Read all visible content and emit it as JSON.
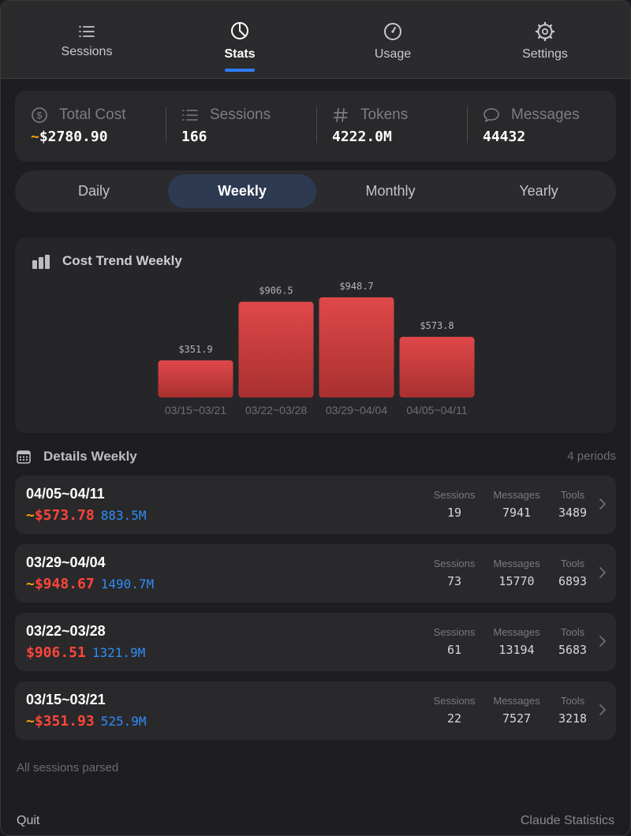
{
  "nav": {
    "tabs": [
      {
        "label": "Sessions",
        "icon": "list-icon"
      },
      {
        "label": "Stats",
        "icon": "pie-chart-icon",
        "active": true
      },
      {
        "label": "Usage",
        "icon": "gauge-icon"
      },
      {
        "label": "Settings",
        "icon": "gear-icon"
      }
    ],
    "accent": "#2f7cf6"
  },
  "summary": {
    "total_cost": {
      "label": "Total Cost",
      "prefix": "~",
      "value": "$2780.90"
    },
    "sessions": {
      "label": "Sessions",
      "value": "166"
    },
    "tokens": {
      "label": "Tokens",
      "value": "4222.0M"
    },
    "messages": {
      "label": "Messages",
      "value": "44432"
    }
  },
  "periods": {
    "options": [
      "Daily",
      "Weekly",
      "Monthly",
      "Yearly"
    ],
    "selected": "Weekly"
  },
  "chart": {
    "title": "Cost Trend Weekly"
  },
  "chart_data": {
    "type": "bar",
    "categories": [
      "03/15~03/21",
      "03/22~03/28",
      "03/29~04/04",
      "04/05~04/11"
    ],
    "values": [
      351.9,
      906.5,
      948.7,
      573.8
    ],
    "value_labels": [
      "$351.9",
      "$906.5",
      "$948.7",
      "$573.8"
    ],
    "title": "Cost Trend Weekly",
    "xlabel": "",
    "ylabel": "",
    "ylim": [
      0,
      948.7
    ],
    "grid": false,
    "bar_color_top": "#e0484a",
    "bar_color_bottom": "#a8302f"
  },
  "details": {
    "title": "Details Weekly",
    "count": "4 periods",
    "metric_labels": {
      "sessions": "Sessions",
      "messages": "Messages",
      "tools": "Tools"
    },
    "rows": [
      {
        "period": "04/05~04/11",
        "prefix": "~",
        "cost": "$573.78",
        "tokens": "883.5M",
        "sessions": "19",
        "messages": "7941",
        "tools": "3489"
      },
      {
        "period": "03/29~04/04",
        "prefix": "~",
        "cost": "$948.67",
        "tokens": "1490.7M",
        "sessions": "73",
        "messages": "15770",
        "tools": "6893"
      },
      {
        "period": "03/22~03/28",
        "prefix": "",
        "cost": "$906.51",
        "tokens": "1321.9M",
        "sessions": "61",
        "messages": "13194",
        "tools": "5683"
      },
      {
        "period": "03/15~03/21",
        "prefix": "~",
        "cost": "$351.93",
        "tokens": "525.9M",
        "sessions": "22",
        "messages": "7527",
        "tools": "3218"
      }
    ]
  },
  "footer": {
    "status": "All sessions parsed",
    "quit_label": "Quit",
    "app_name": "Claude Statistics"
  },
  "colors": {
    "cost_red": "#ff453a",
    "tilde_orange": "#ff9f0a",
    "tokens_blue": "#2f8cf7"
  }
}
